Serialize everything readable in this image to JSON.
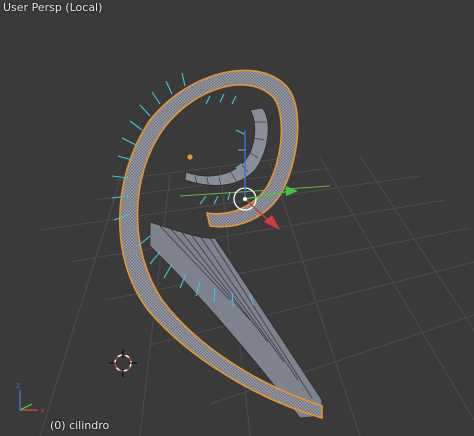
{
  "viewport": {
    "view_name": "User Persp (Local)",
    "active_object": "(0) cilindro"
  },
  "colors": {
    "background": "#3a3a3a",
    "grid": "#4a4a4a",
    "selection_outline": "#e8962c",
    "mesh_face": "#8a8d9a",
    "mesh_edge": "#2a2a2a",
    "normals": "#45c7d8",
    "axis_x": "#d83a3a",
    "axis_y": "#3fc93f",
    "axis_z": "#3a6fd8",
    "cursor": "#d83a3a"
  },
  "icons": {
    "cursor": "3d-cursor-icon",
    "axes": "axis-gizmo-icon",
    "pivot": "object-origin-icon",
    "manipulator": "transform-manipulator-icon"
  }
}
